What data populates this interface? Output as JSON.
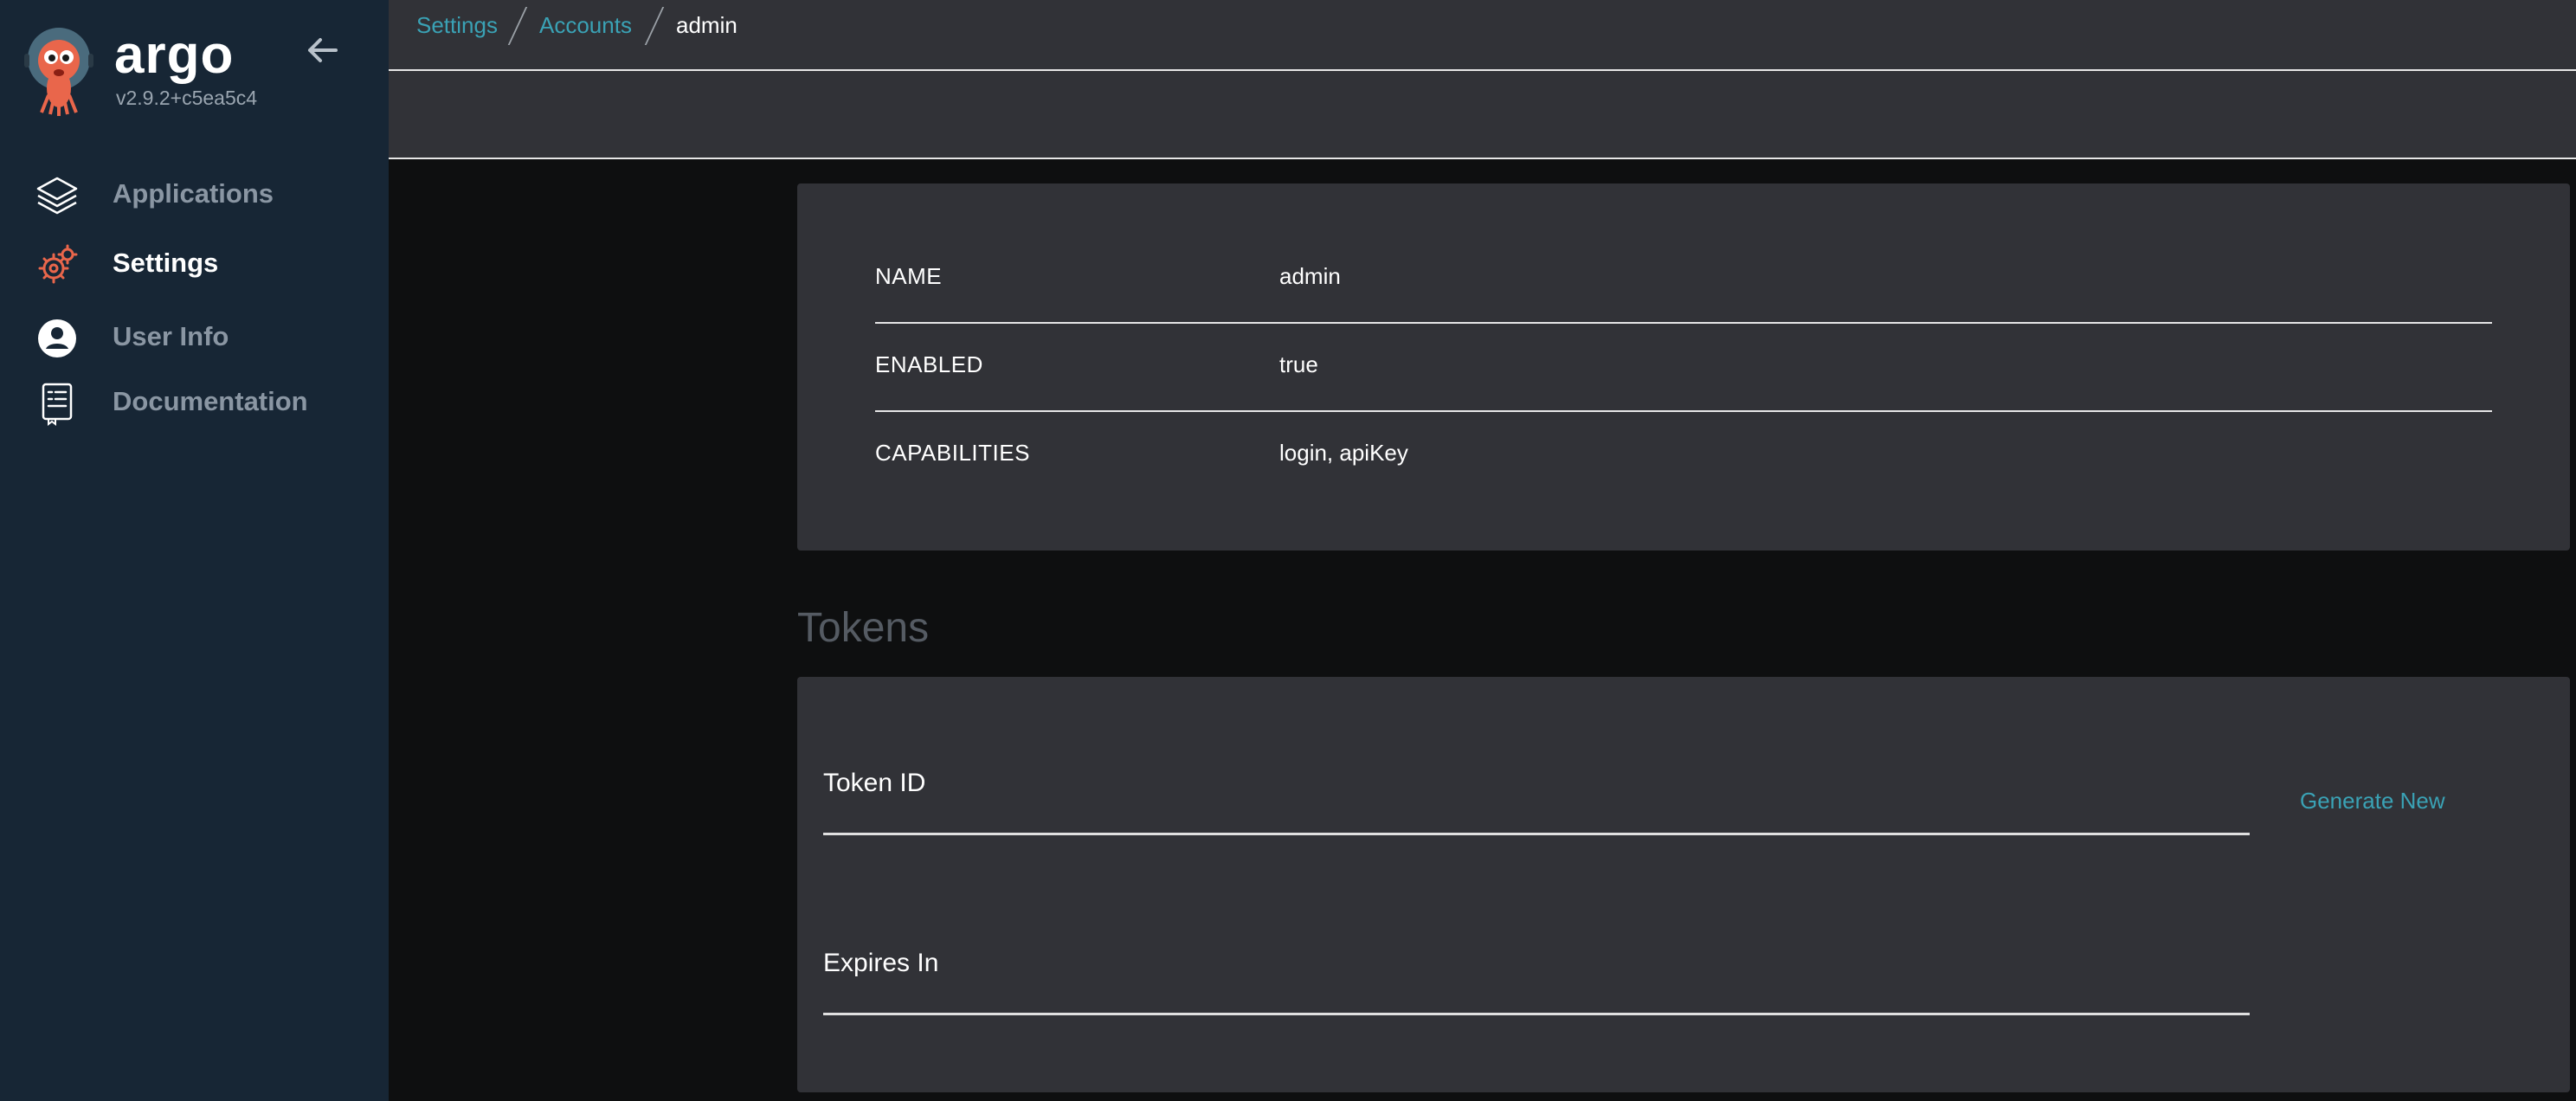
{
  "sidebar": {
    "brand": "argo",
    "version": "v2.9.2+c5ea5c4",
    "items": [
      {
        "label": "Applications",
        "icon": "layers-icon"
      },
      {
        "label": "Settings",
        "icon": "gear-icon",
        "active": true
      },
      {
        "label": "User Info",
        "icon": "user-circle-icon"
      },
      {
        "label": "Documentation",
        "icon": "document-icon"
      }
    ]
  },
  "breadcrumb": {
    "items": [
      "Settings",
      "Accounts"
    ],
    "current": "admin"
  },
  "account": {
    "rows": [
      {
        "key": "NAME",
        "value": "admin"
      },
      {
        "key": "ENABLED",
        "value": "true"
      },
      {
        "key": "CAPABILITIES",
        "value": "login, apiKey"
      }
    ]
  },
  "tokens": {
    "title": "Tokens",
    "token_id_label": "Token ID",
    "expires_in_label": "Expires In",
    "generate_label": "Generate New"
  },
  "colors": {
    "sidebar_bg": "#172635",
    "panel_bg": "#313237",
    "page_bg": "#0e0f10",
    "accent": "#3aa2b5",
    "settings_icon": "#e9664b"
  }
}
